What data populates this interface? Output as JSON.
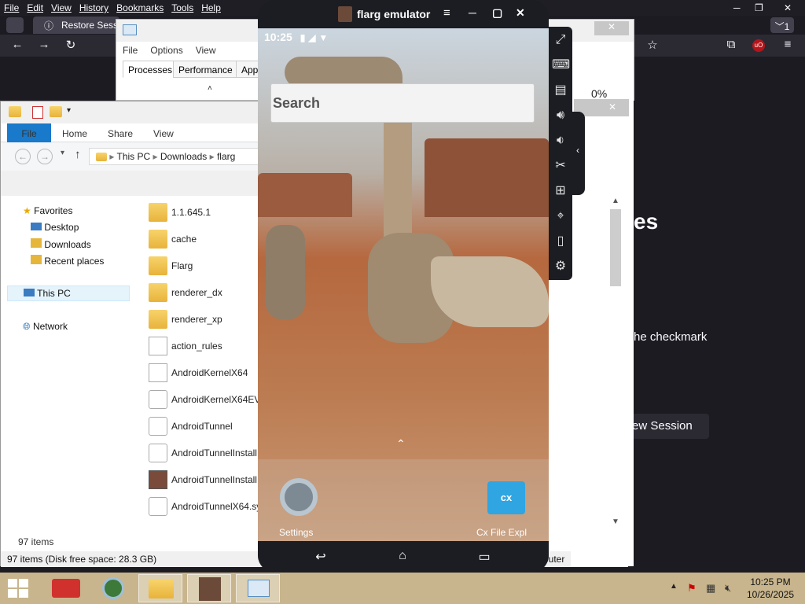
{
  "firefox": {
    "menu": [
      "File",
      "Edit",
      "View",
      "History",
      "Bookmarks",
      "Tools",
      "Help"
    ],
    "tab_title": "Restore Sessi",
    "tab_count": "1",
    "page_heading_fragment": "es",
    "page_text_fragment": "he checkmark",
    "session_button_fragment": "ew Session",
    "zoom_fragment": "0%"
  },
  "task_manager": {
    "menu": [
      "File",
      "Options",
      "View"
    ],
    "tabs": [
      "Processes",
      "Performance",
      "App"
    ]
  },
  "explorer": {
    "ribbon": {
      "file": "File",
      "home": "Home",
      "share": "Share",
      "view": "View"
    },
    "breadcrumb": [
      "This PC",
      "Downloads",
      "flarg"
    ],
    "nav": {
      "favorites": "Favorites",
      "desktop": "Desktop",
      "downloads": "Downloads",
      "recent": "Recent places",
      "this_pc": "This PC",
      "network": "Network"
    },
    "files": [
      {
        "name": "1.1.645.1",
        "icon": "folder-icon"
      },
      {
        "name": "cache",
        "icon": "folder-icon"
      },
      {
        "name": "Flarg",
        "icon": "folder-icon"
      },
      {
        "name": "renderer_dx",
        "icon": "folder-icon"
      },
      {
        "name": "renderer_xp",
        "icon": "folder-icon"
      },
      {
        "name": "action_rules",
        "icon": "document-icon"
      },
      {
        "name": "AndroidKernelX64",
        "icon": "document-icon"
      },
      {
        "name": "AndroidKernelX64EV",
        "icon": "gear-file-icon"
      },
      {
        "name": "AndroidTunnel",
        "icon": "gear-file-icon"
      },
      {
        "name": "AndroidTunnelInstall",
        "icon": "gear-file-icon"
      },
      {
        "name": "AndroidTunnelInstall",
        "icon": "image-file-icon"
      },
      {
        "name": "AndroidTunnelX64.sy",
        "icon": "gear-file-icon"
      }
    ],
    "item_count": "97 items",
    "status": "97 items (Disk free space: 28.3 GB)",
    "computer_fragment": "puter"
  },
  "emulator": {
    "title": "flarg emulator",
    "time": "10:25",
    "search_placeholder": "Search",
    "apps": [
      "Settings",
      "Cx File Expl"
    ]
  },
  "taskbar": {
    "time": "10:25 PM",
    "date": "10/26/2025"
  }
}
